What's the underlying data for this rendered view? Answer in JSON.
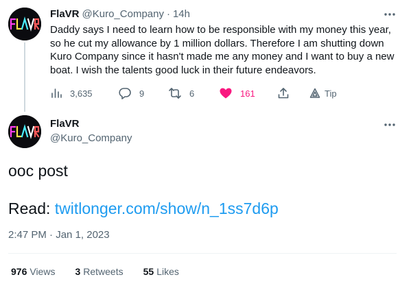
{
  "reply_tweet": {
    "display_name": "FlaVR",
    "handle": "@Kuro_Company",
    "separator": "·",
    "time_ago": "14h",
    "avatar_logo_text": "FLAVR",
    "text": "Daddy says I need to learn how to be responsible with my money this year, so he cut my allowance by 1 million dollars. Therefore I am shutting down Kuro Company since it hasn't made me any money and I want to buy a new boat. I wish the talents good luck in their future endeavors.",
    "actions": {
      "views": "3,635",
      "replies": "9",
      "retweets": "6",
      "likes": "161",
      "tip_label": "Tip"
    },
    "like_color": "#f91880"
  },
  "main_tweet": {
    "display_name": "FlaVR",
    "handle": "@Kuro_Company",
    "avatar_logo_text": "FLAVR",
    "text_line1": "ooc post",
    "read_prefix": "Read: ",
    "link_text": "twitlonger.com/show/n_1ss7d6p",
    "time": "2:47 PM",
    "separator": "·",
    "date": "Jan 1, 2023",
    "stats": {
      "views_count": "976",
      "views_label": "Views",
      "retweets_count": "3",
      "retweets_label": "Retweets",
      "likes_count": "55",
      "likes_label": "Likes"
    }
  },
  "colors": {
    "text_primary": "#0f1419",
    "text_secondary": "#536471",
    "link": "#1d9bf0",
    "like": "#f91880"
  }
}
